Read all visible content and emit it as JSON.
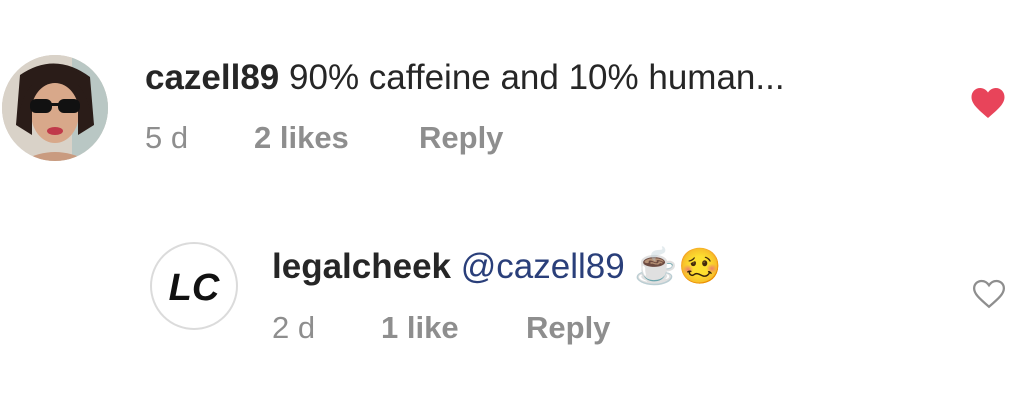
{
  "comments": [
    {
      "username": "cazell89",
      "text": "90% caffeine and 10% human...",
      "time": "5 d",
      "likes": "2 likes",
      "reply": "Reply",
      "liked": true,
      "avatar": "profile-photo-woman-sunglasses"
    },
    {
      "username": "legalcheek",
      "mention": "@cazell89",
      "emoji": "☕🥴",
      "time": "2 d",
      "likes": "1 like",
      "reply": "Reply",
      "liked": false,
      "avatar": "lc-logo",
      "logo_text": "LC"
    }
  ],
  "colors": {
    "heart_liked": "#e8445a",
    "meta": "#8e8e8e",
    "mention": "#2a3f7a"
  }
}
